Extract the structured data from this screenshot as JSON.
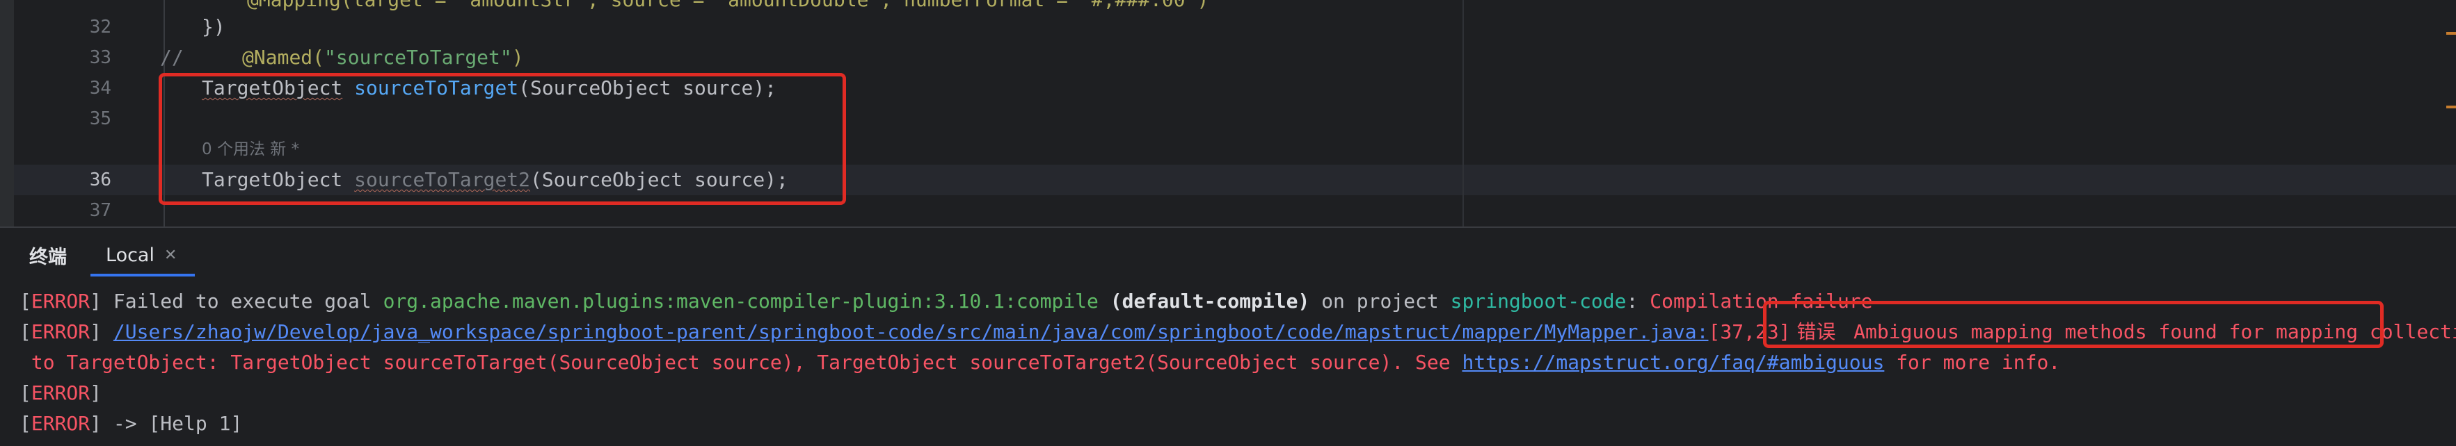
{
  "editor": {
    "lines": [
      {
        "number": "32",
        "text": "})"
      },
      {
        "number": "33",
        "comment": "//",
        "annotation": "@Named(",
        "string": "\"sourceToTarget\"",
        "close": ")"
      },
      {
        "number": "34",
        "type": "TargetObject",
        "method": "sourceToTarget",
        "params": "(SourceObject source);"
      },
      {
        "number": "35"
      },
      {
        "number": "36",
        "type": "TargetObject",
        "method": "sourceToTarget2",
        "params": "(SourceObject source);"
      },
      {
        "number": "37"
      }
    ],
    "top_fragment": "@Mapping(target = \"amountStr\", source = \"amountDouble\", numberFormat = \"#,###.00\")",
    "usage_hint": "0 个用法   新 *"
  },
  "terminal": {
    "title": "终端",
    "tab_label": "Local",
    "lines": [
      {
        "tag": "ERROR",
        "text1": " Failed to execute goal ",
        "plugin": "org.apache.maven.plugins:maven-compiler-plugin:3.10.1:compile",
        "phase": " (default-compile)",
        "text2": " on project ",
        "project": "springboot-code",
        "text3": ": ",
        "failure": "Compilation failure"
      },
      {
        "tag": "ERROR",
        "path": "/Users/zhaojw/Develop/java_workspace/springboot-parent/springboot-code/src/main/java/com/springboot/code/mapstruct/mapper/MyMapper.java:",
        "pos": "[37,23]",
        "cn": " 错误 ",
        "msg": "Ambiguous mapping methods found for mapping collection eleme"
      },
      {
        "cont": " to TargetObject: TargetObject sourceToTarget(SourceObject source), TargetObject sourceToTarget2(SourceObject source). See ",
        "url": "https://mapstruct.org/faq/#ambiguous",
        "tail": " for more info."
      },
      {
        "tag": "ERROR"
      },
      {
        "tag": "ERROR",
        "text": " -> [Help 1]"
      }
    ]
  }
}
